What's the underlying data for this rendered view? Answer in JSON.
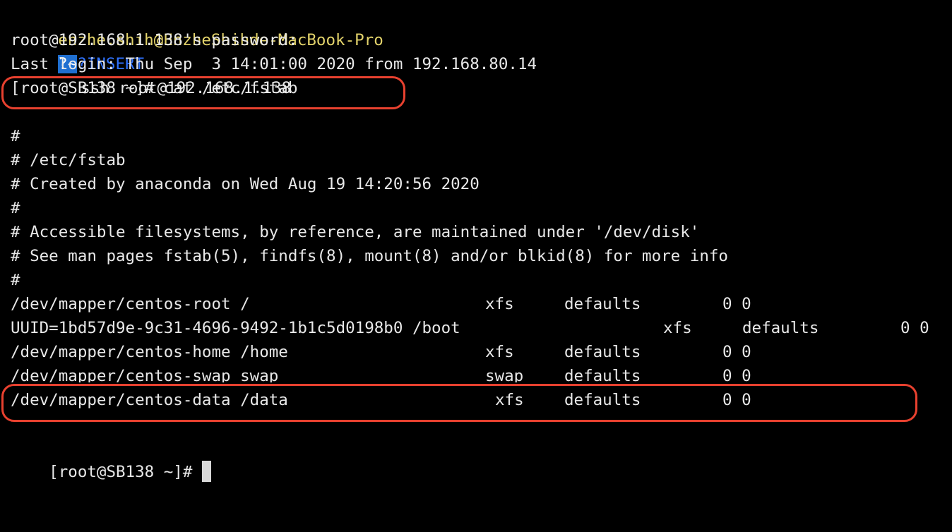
{
  "colors": {
    "background": "#000000",
    "text": "#e8e8e8",
    "prompt_user": "#e3d36b",
    "badge_bg": "#1f6fd1",
    "mode": "#2f72ff",
    "highlight_border": "#e8412f"
  },
  "status": {
    "user_host": "enzhe.shih@EnzheShihde-MacBook-Pro",
    "badge": "?~",
    "badge_icon": "question-box-icon",
    "mode": "?INSERT",
    "command": "ssh root@192.168.1.138"
  },
  "session": {
    "password_prompt": "root@192.168.1.138's password:",
    "last_login": "Last login: Thu Sep  3 14:01:00 2020 from 192.168.80.14",
    "prompt_cmd": "[root@SB138 ~]# cat /etc/fstab",
    "final_prompt": "[root@SB138 ~]#"
  },
  "comments": [
    "#",
    "# /etc/fstab",
    "# Created by anaconda on Wed Aug 19 14:20:56 2020",
    "#",
    "# Accessible filesystems, by reference, are maintained under '/dev/disk'",
    "# See man pages fstab(5), findfs(8), mount(8) and/or blkid(8) for more info",
    "#"
  ],
  "fstab": [
    {
      "device": "/dev/mapper/centos-root /",
      "type": "xfs",
      "options": "defaults",
      "dump_pass": "0 0"
    },
    {
      "device": "UUID=1bd57d9e-9c31-4696-9492-1b1c5d0198b0 /boot",
      "type": "xfs",
      "options": "defaults",
      "dump_pass": "0 0"
    },
    {
      "device": "/dev/mapper/centos-home /home",
      "type": "xfs",
      "options": "defaults",
      "dump_pass": "0 0"
    },
    {
      "device": "/dev/mapper/centos-swap swap",
      "type": "swap",
      "options": "defaults",
      "dump_pass": "0 0"
    },
    {
      "device": "/dev/mapper/centos-data /data",
      "type": "xfs",
      "options": "defaults",
      "dump_pass": "0 0"
    }
  ]
}
